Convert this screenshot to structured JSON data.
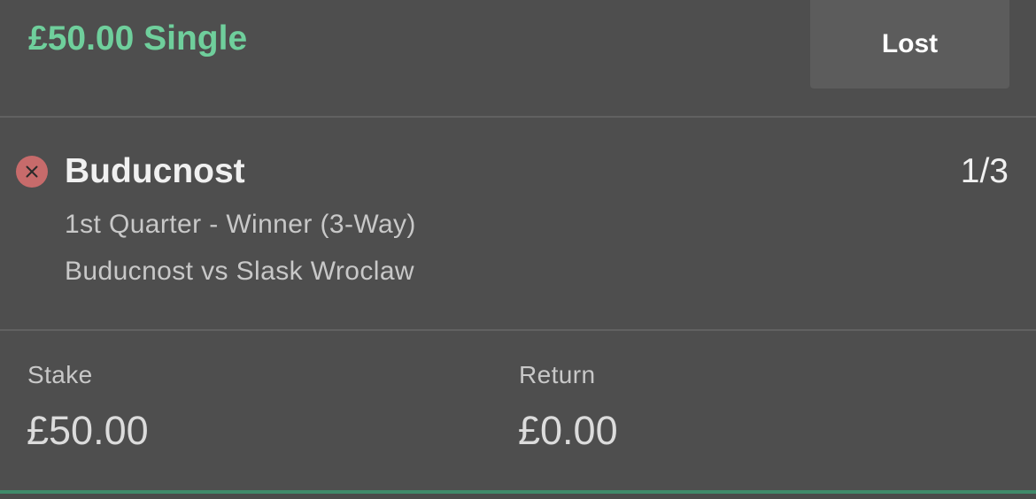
{
  "bet": {
    "title": "£50.00 Single",
    "status_label": "Lost"
  },
  "selection": {
    "status_icon": "close-icon",
    "name": "Buducnost",
    "odds": "1/3",
    "market": "1st Quarter - Winner (3-Way)",
    "event": "Buducnost vs Slask Wroclaw"
  },
  "summary": {
    "stake_label": "Stake",
    "stake_value": "£50.00",
    "return_label": "Return",
    "return_value": "£0.00"
  },
  "colors": {
    "background": "#4e4e4e",
    "accent_green": "#6fcf9c",
    "lost_red": "#c76b6b",
    "bottom_bar": "#3f8a6a"
  }
}
